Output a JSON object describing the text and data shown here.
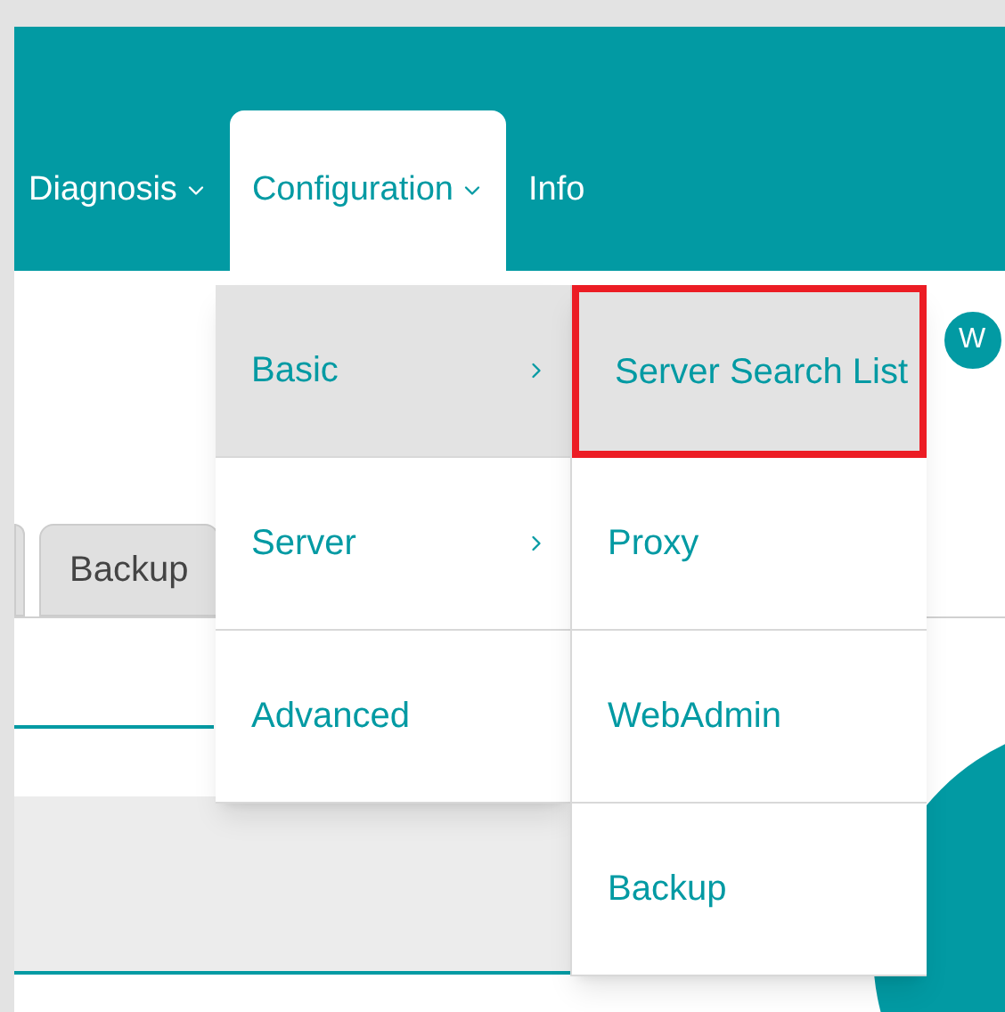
{
  "nav": [
    {
      "label": "Diagnosis",
      "dropdown": true,
      "selected": false
    },
    {
      "label": "Configuration",
      "dropdown": true,
      "selected": true
    },
    {
      "label": "Info",
      "dropdown": false,
      "selected": false
    }
  ],
  "menu": {
    "items": [
      {
        "label": "Basic",
        "submenu": true,
        "selected": true
      },
      {
        "label": "Server",
        "submenu": true,
        "selected": false
      },
      {
        "label": "Advanced",
        "submenu": false,
        "selected": false
      }
    ]
  },
  "submenu": {
    "items": [
      {
        "label": "Server Search List",
        "selected": true
      },
      {
        "label": "Proxy",
        "selected": false
      },
      {
        "label": "WebAdmin",
        "selected": false
      },
      {
        "label": "Backup",
        "selected": false
      }
    ]
  },
  "page": {
    "tabs": [
      {
        "label": "Backup"
      }
    ],
    "badge": "W"
  }
}
